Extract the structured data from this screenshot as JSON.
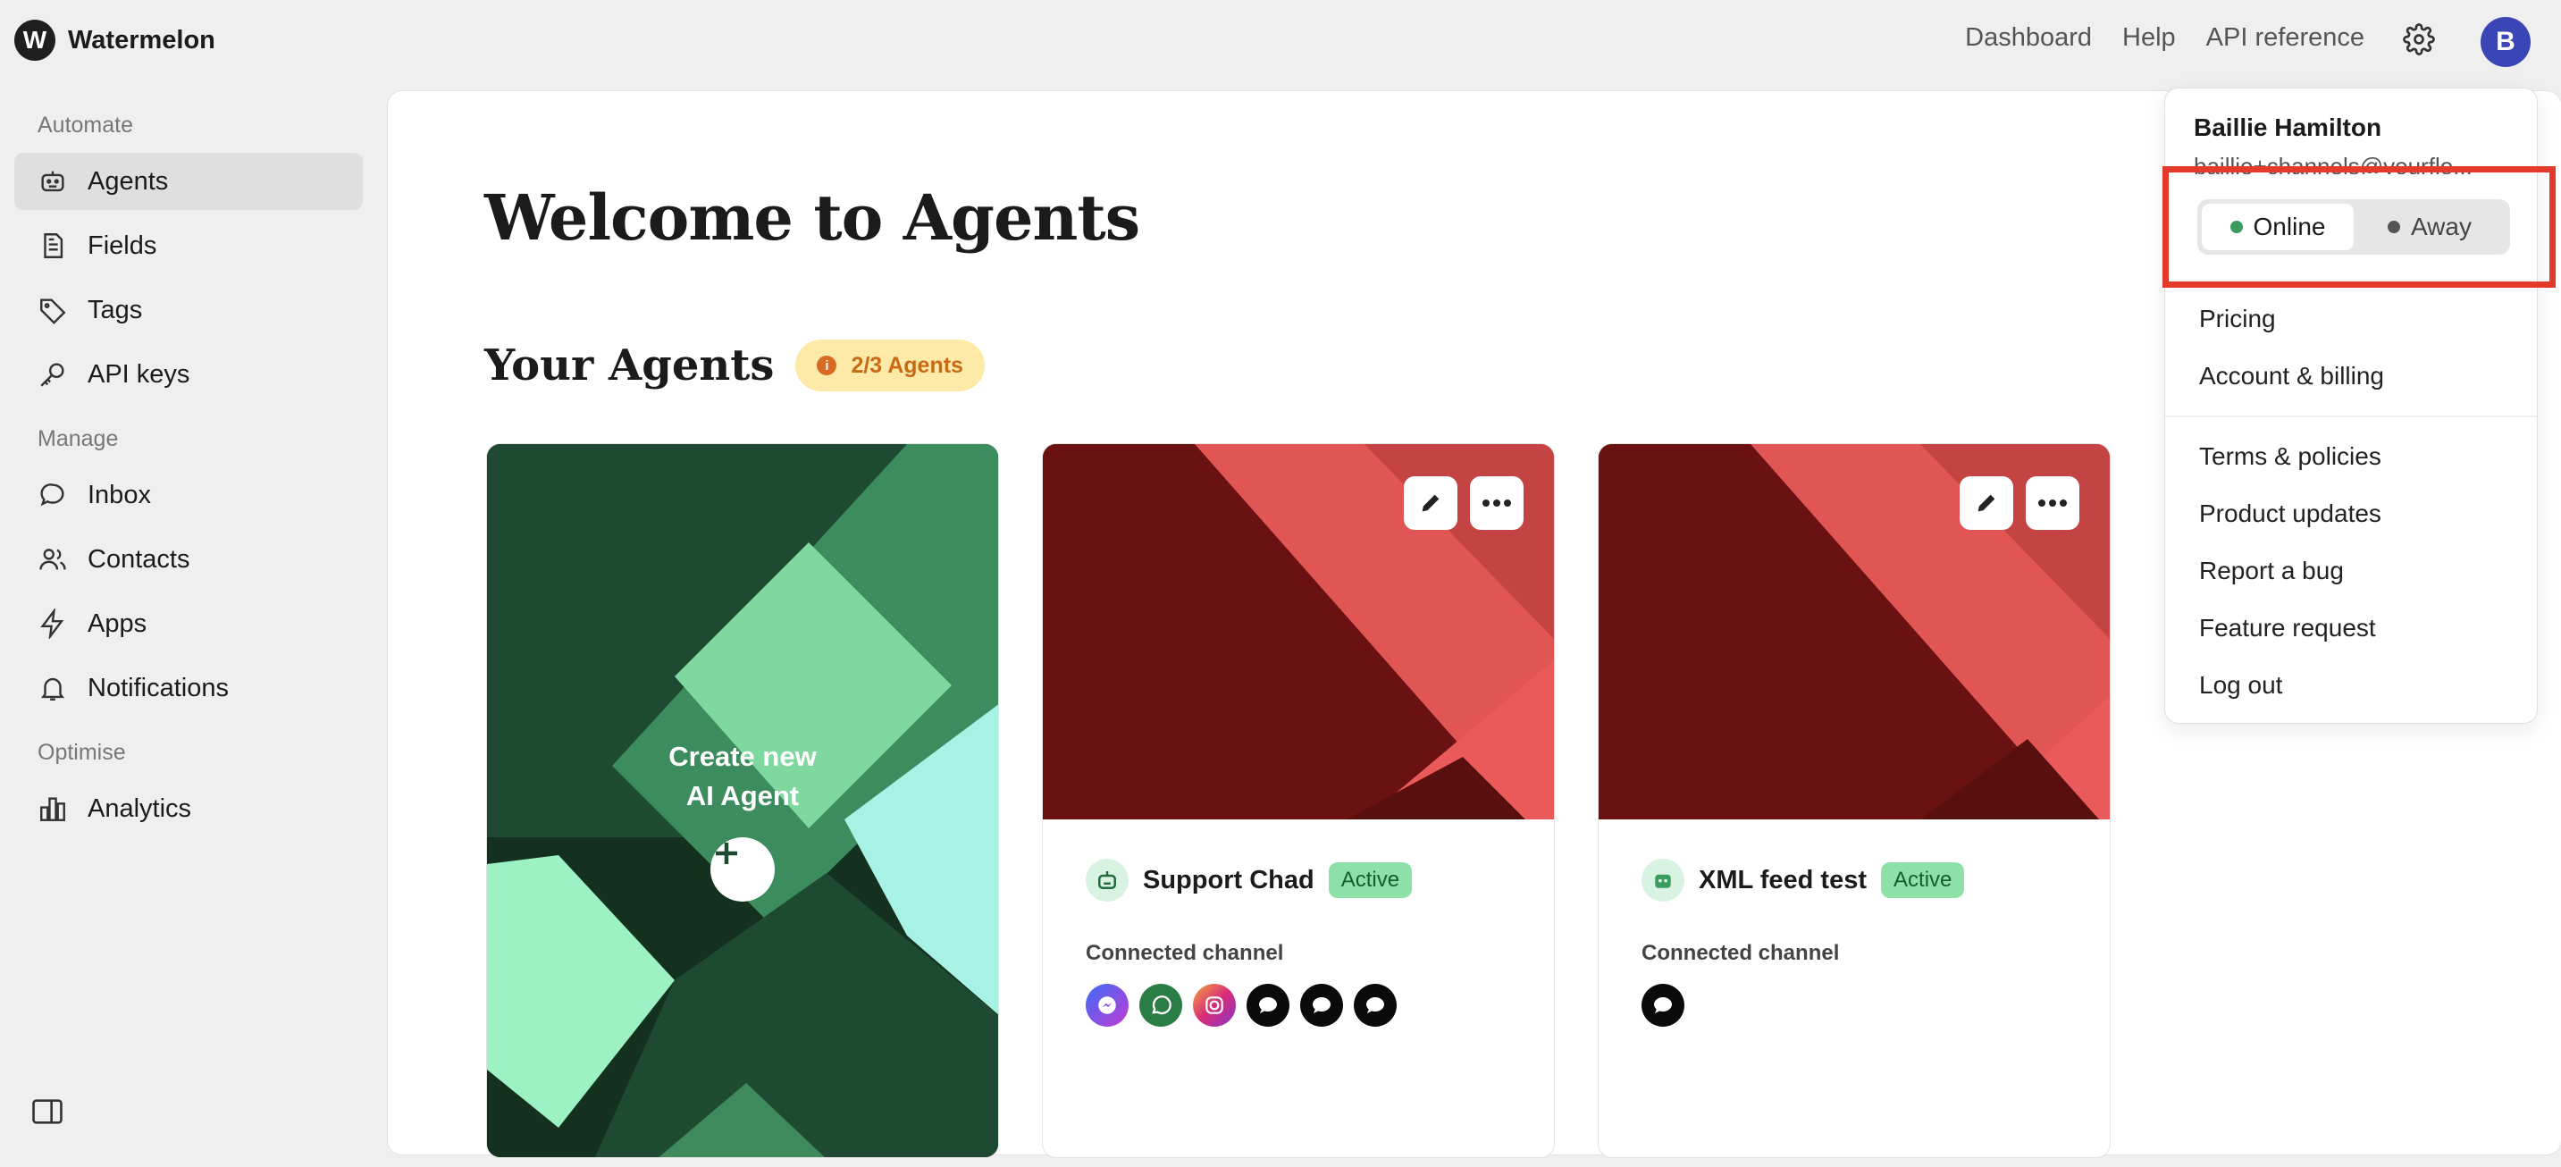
{
  "app": {
    "logo_letter": "W",
    "name": "Watermelon"
  },
  "topnav": {
    "dashboard": "Dashboard",
    "help": "Help",
    "api": "API reference",
    "avatar_letter": "B"
  },
  "sidebar": {
    "automate": "Automate",
    "manage": "Manage",
    "optimise": "Optimise",
    "items": [
      {
        "label": "Agents",
        "icon": "agent-icon"
      },
      {
        "label": "Fields",
        "icon": "document-icon"
      },
      {
        "label": "Tags",
        "icon": "tag-icon"
      },
      {
        "label": "API keys",
        "icon": "key-icon"
      },
      {
        "label": "Inbox",
        "icon": "chat-icon"
      },
      {
        "label": "Contacts",
        "icon": "users-icon"
      },
      {
        "label": "Apps",
        "icon": "bolt-icon"
      },
      {
        "label": "Notifications",
        "icon": "bell-icon"
      },
      {
        "label": "Analytics",
        "icon": "chart-icon"
      }
    ]
  },
  "main": {
    "title": "Welcome to Agents",
    "section_title": "Your Agents",
    "quota": "2/3 Agents",
    "create_line1": "Create new",
    "create_line2": "AI Agent",
    "agents": [
      {
        "name": "Support Chad",
        "status": "Active",
        "connected_label": "Connected channel"
      },
      {
        "name": "XML feed test",
        "status": "Active",
        "connected_label": "Connected channel"
      }
    ]
  },
  "menu": {
    "user_name": "Baillie Hamilton",
    "user_email": "baillie+channels@yourflo...",
    "online": "Online",
    "away": "Away",
    "items_top": [
      "Pricing",
      "Account & billing"
    ],
    "items_bottom": [
      "Terms & policies",
      "Product updates",
      "Report a bug",
      "Feature request",
      "Log out"
    ]
  },
  "colors": {
    "accent": "#3b46b6",
    "online": "#3c9a5f",
    "highlight": "#e53a2a",
    "active_badge": "#8ee0a9"
  }
}
